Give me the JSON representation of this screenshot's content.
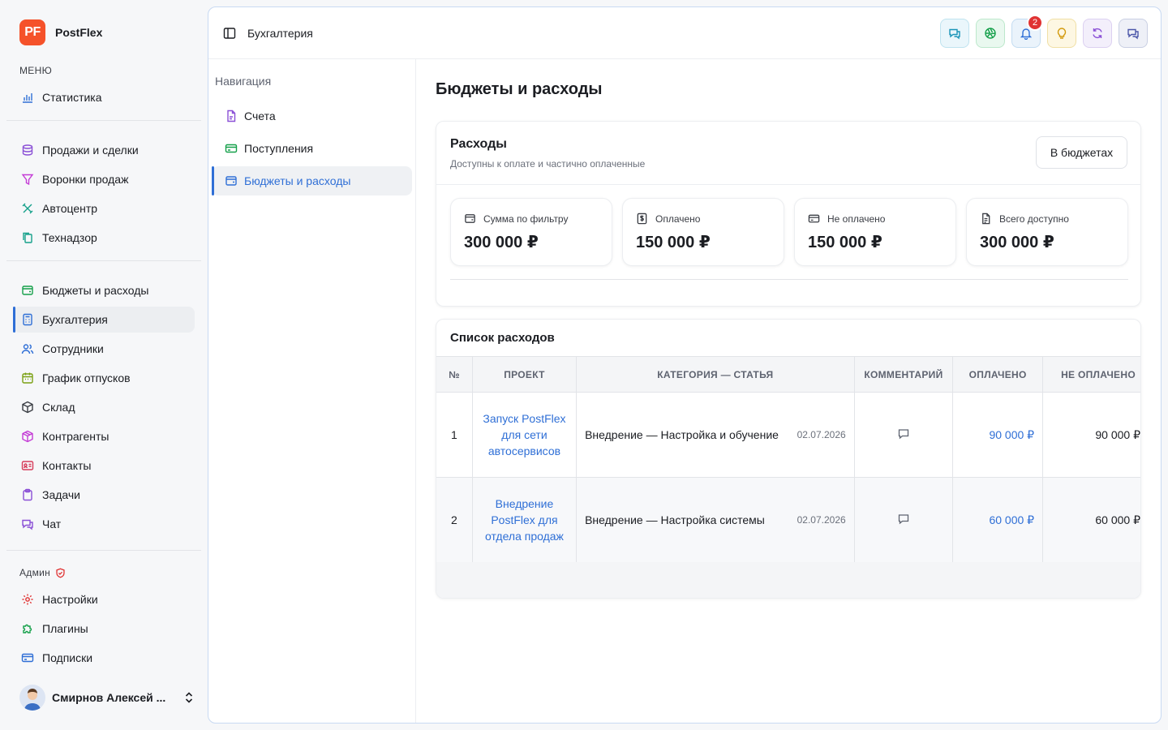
{
  "brand": {
    "logo_text": "PF",
    "name": "PostFlex",
    "logo_color": "#f5522a"
  },
  "sidebar": {
    "menu_label": "МЕНЮ",
    "group1": [
      {
        "label": "Статистика",
        "icon": "bar-chart-icon"
      }
    ],
    "group2": [
      {
        "label": "Продажи и сделки",
        "icon": "database-icon"
      },
      {
        "label": "Воронки продаж",
        "icon": "funnel-icon"
      },
      {
        "label": "Автоцентр",
        "icon": "wrench-icon"
      },
      {
        "label": "Технадзор",
        "icon": "copy-icon"
      }
    ],
    "group3": [
      {
        "label": "Бюджеты и расходы",
        "icon": "wallet-icon"
      },
      {
        "label": "Бухгалтерия",
        "icon": "calculator-icon",
        "active": true
      },
      {
        "label": "Сотрудники",
        "icon": "users-icon"
      },
      {
        "label": "График отпусков",
        "icon": "calendar-icon"
      },
      {
        "label": "Склад",
        "icon": "box-icon"
      },
      {
        "label": "Контрагенты",
        "icon": "package-icon"
      },
      {
        "label": "Контакты",
        "icon": "id-card-icon"
      },
      {
        "label": "Задачи",
        "icon": "clipboard-icon"
      },
      {
        "label": "Чат",
        "icon": "chat-icon"
      }
    ],
    "admin_label": "Админ",
    "admin": [
      {
        "label": "Настройки",
        "icon": "gear-icon"
      },
      {
        "label": "Плагины",
        "icon": "puzzle-icon"
      },
      {
        "label": "Подписки",
        "icon": "credit-card-icon"
      }
    ],
    "user_name": "Смирнов Алексей ..."
  },
  "topbar": {
    "title": "Бухгалтерия",
    "notifications_count": "2",
    "accent": "#2f6fd6"
  },
  "subnav": {
    "title": "Навигация",
    "items": [
      {
        "label": "Счета",
        "icon": "file-icon"
      },
      {
        "label": "Поступления",
        "icon": "card-icon"
      },
      {
        "label": "Бюджеты и расходы",
        "icon": "wallet-icon",
        "active": true
      }
    ]
  },
  "page": {
    "title": "Бюджеты и расходы",
    "expenses_card": {
      "title": "Расходы",
      "subtitle": "Доступны к оплате и частично оплаченные",
      "button": "В бюджетах",
      "stats": [
        {
          "label": "Сумма по фильтру",
          "value": "300 000 ₽",
          "icon": "wallet-icon"
        },
        {
          "label": "Оплачено",
          "value": "150 000 ₽",
          "icon": "dollar-icon"
        },
        {
          "label": "Не оплачено",
          "value": "150 000 ₽",
          "icon": "card-icon"
        },
        {
          "label": "Всего доступно",
          "value": "300 000 ₽",
          "icon": "document-icon"
        }
      ]
    },
    "list_card": {
      "title": "Список расходов",
      "columns": [
        "№",
        "ПРОЕКТ",
        "КАТЕГОРИЯ — СТАТЬЯ",
        "КОММЕНТАРИЙ",
        "ОПЛАЧЕНО",
        "НЕ ОПЛАЧЕНО"
      ],
      "rows": [
        {
          "num": "1",
          "project": "Запуск PostFlex для сети автосервисов",
          "category": "Внедрение — Настройка и обучение",
          "date": "02.07.2026",
          "paid": "90 000 ₽",
          "unpaid": "90 000 ₽"
        },
        {
          "num": "2",
          "project": "Внедрение PostFlex для отдела продаж",
          "category": "Внедрение — Настройка системы",
          "date": "02.07.2026",
          "paid": "60 000 ₽",
          "unpaid": "60 000 ₽"
        }
      ]
    }
  }
}
